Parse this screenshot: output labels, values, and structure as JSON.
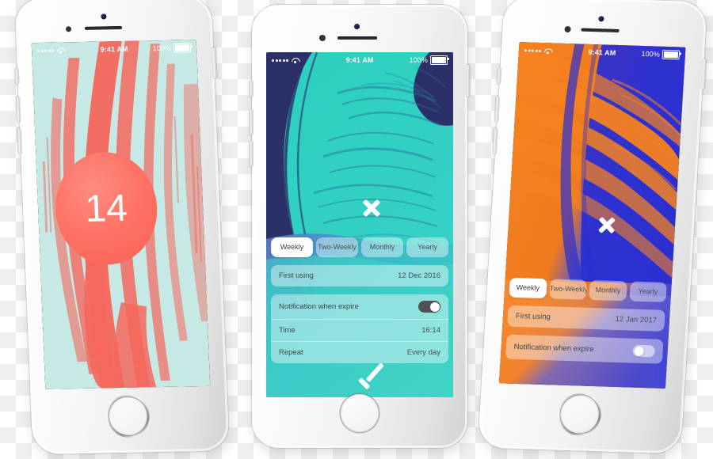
{
  "scene": {
    "title": "Subscription Reminder App — iPhone Mockups",
    "background": "transparency-checkerboard",
    "device_count": 3
  },
  "status_bar": {
    "carrier_dots": 5,
    "wifi_icon": "wifi-icon",
    "time": "9:41 AM",
    "battery_percent": "100%",
    "battery_icon": "battery-full-icon"
  },
  "phones": [
    {
      "id": "phone-left",
      "device": "iPhone white",
      "screen_name": "counter-screen",
      "theme": {
        "background": "#c7e9e6",
        "brush": "#f4675c",
        "badge_fill": "#fd7265"
      },
      "status_bar": {
        "time": "9:41 AM",
        "battery_percent": "100%"
      },
      "badge": {
        "label": "14",
        "name": "days-remaining-badge"
      }
    },
    {
      "id": "phone-mid",
      "device": "iPhone white",
      "screen_name": "subscription-settings-screen",
      "theme": {
        "background": "#2bd0bb",
        "accent_dark": "#2b3069",
        "accent": "#35c9c0"
      },
      "status_bar": {
        "time": "9:41 AM",
        "battery_percent": "100%"
      },
      "close_icon": "close-x-icon",
      "confirm_icon": "checkmark-icon",
      "segments": [
        {
          "label": "Weekly",
          "selected": true
        },
        {
          "label": "Two-Weekly",
          "selected": false
        },
        {
          "label": "Monthly",
          "selected": false
        },
        {
          "label": "Yearly",
          "selected": false
        }
      ],
      "rows": [
        {
          "label": "First using",
          "value": "12 Dec 2016",
          "type": "value"
        },
        {
          "label": "Notification when expire",
          "value": "",
          "type": "toggle",
          "toggle_on": true
        },
        {
          "label": "Time",
          "value": "16:14",
          "type": "value"
        },
        {
          "label": "Repeat",
          "value": "Every day",
          "type": "value"
        }
      ]
    },
    {
      "id": "phone-right",
      "device": "iPhone white",
      "screen_name": "subscription-settings-screen-alt",
      "theme": {
        "background": "#f58220",
        "accent": "#2b2fd0"
      },
      "status_bar": {
        "time": "9:41 AM",
        "battery_percent": "100%"
      },
      "close_icon": "close-x-icon",
      "segments": [
        {
          "label": "Weekly",
          "selected": true
        },
        {
          "label": "Two-Weekly",
          "selected": false
        },
        {
          "label": "Monthly",
          "selected": false
        },
        {
          "label": "Yearly",
          "selected": false
        }
      ],
      "rows": [
        {
          "label": "First using",
          "value": "12 Jan 2017",
          "type": "value"
        },
        {
          "label": "Notification when expire",
          "value": "",
          "type": "toggle",
          "toggle_on": false
        }
      ]
    }
  ]
}
